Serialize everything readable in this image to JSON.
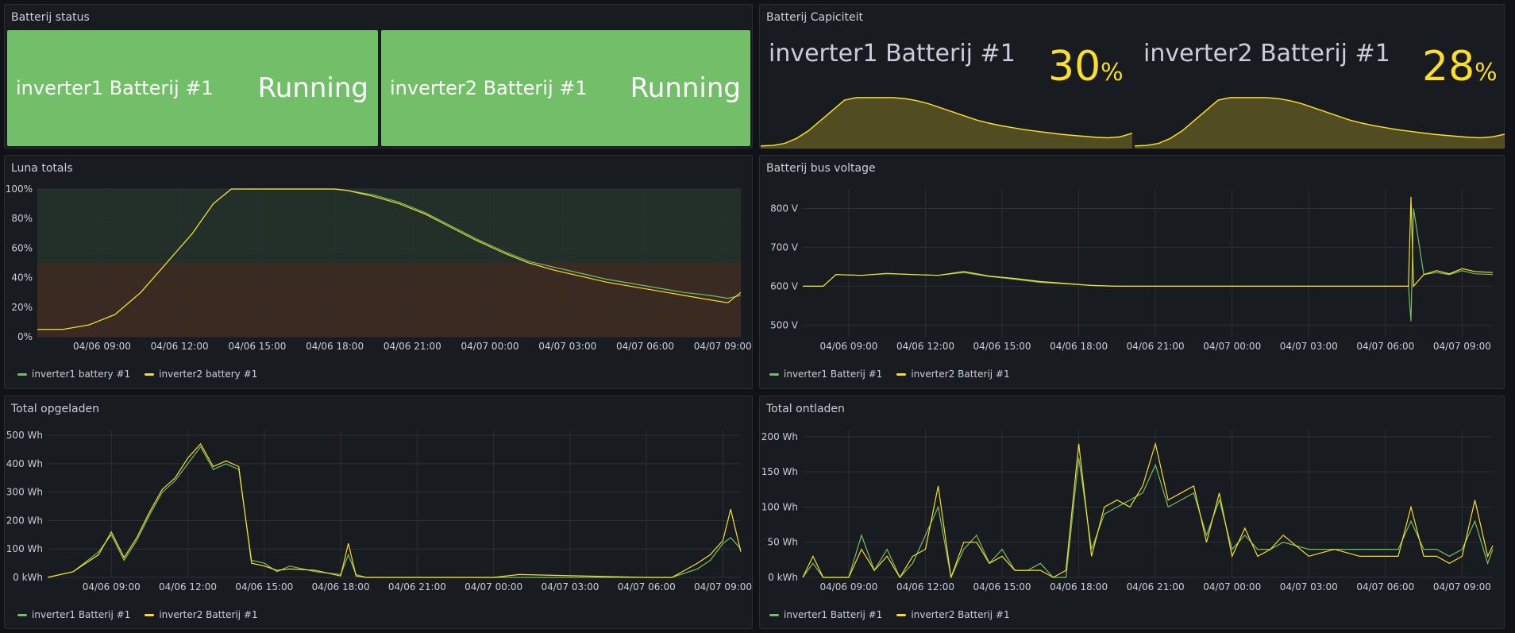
{
  "colors": {
    "green": "#73bf69",
    "yellow": "#fade2a",
    "panel_bg": "#181b1f",
    "page_bg": "#111217"
  },
  "batterij_status": {
    "title": "Batterij status",
    "items": [
      {
        "name": "inverter1 Batterij #1",
        "value": "Running"
      },
      {
        "name": "inverter2 Batterij #1",
        "value": "Running"
      }
    ]
  },
  "batterij_capiciteit": {
    "title": "Batterij Capiciteit",
    "items": [
      {
        "name": "inverter1 Batterij #1",
        "value": "30",
        "unit": "%"
      },
      {
        "name": "inverter2 Batterij #1",
        "value": "28",
        "unit": "%"
      }
    ]
  },
  "luna_totals": {
    "title": "Luna totals",
    "legend": [
      "inverter1 battery #1",
      "inverter2 battery #1"
    ]
  },
  "bus_voltage": {
    "title": "Batterij bus voltage",
    "legend": [
      "inverter1 Batterij #1",
      "inverter2 Batterij #1"
    ]
  },
  "opgeladen": {
    "title": "Total opgeladen",
    "legend": [
      "inverter1 Batterij #1",
      "inverter2 Batterij #1"
    ]
  },
  "ontladen": {
    "title": "Total ontladen",
    "legend": [
      "inverter1 Batterij #1",
      "inverter2 Batterij #1"
    ]
  },
  "chart_data": [
    {
      "type": "area",
      "id": "cap1",
      "series": [
        {
          "name": "inverter1 Batterij #1",
          "values": [
            5,
            6,
            10,
            20,
            35,
            55,
            75,
            95,
            100,
            100,
            100,
            100,
            98,
            94,
            88,
            80,
            72,
            64,
            56,
            50,
            45,
            41,
            37,
            34,
            31,
            28,
            26,
            24,
            22,
            21,
            23,
            30
          ]
        }
      ],
      "ylim": [
        0,
        120
      ]
    },
    {
      "type": "area",
      "id": "cap2",
      "series": [
        {
          "name": "inverter2 Batterij #1",
          "values": [
            5,
            6,
            10,
            20,
            35,
            55,
            75,
            95,
            100,
            100,
            100,
            100,
            98,
            94,
            88,
            80,
            72,
            64,
            56,
            50,
            45,
            41,
            37,
            34,
            31,
            28,
            26,
            24,
            22,
            21,
            23,
            28
          ]
        }
      ],
      "ylim": [
        0,
        120
      ]
    },
    {
      "type": "line",
      "id": "luna",
      "title": "Luna totals",
      "x_ticks": [
        "04/06 09:00",
        "04/06 12:00",
        "04/06 15:00",
        "04/06 18:00",
        "04/06 21:00",
        "04/07 00:00",
        "04/07 03:00",
        "04/07 06:00",
        "04/07 09:00"
      ],
      "y_ticks": [
        "0%",
        "20%",
        "40%",
        "60%",
        "80%",
        "100%"
      ],
      "ylim": [
        0,
        100
      ],
      "xlim": [
        6.5,
        33.7
      ],
      "x": [
        6.5,
        7.5,
        8.5,
        9.5,
        10.5,
        11.5,
        12.5,
        13.3,
        14,
        15,
        16,
        17,
        18,
        18.5,
        19.5,
        20.5,
        21.5,
        22.5,
        23.5,
        24.5,
        25.5,
        26.5,
        27.5,
        28.5,
        29.5,
        30.5,
        31.5,
        32.5,
        33.2,
        33.7
      ],
      "series": [
        {
          "name": "inverter1 battery #1",
          "values": [
            5,
            5,
            8,
            15,
            30,
            50,
            70,
            90,
            100,
            100,
            100,
            100,
            100,
            99,
            96,
            91,
            84,
            75,
            66,
            58,
            51,
            47,
            43,
            39,
            36,
            33,
            30,
            28,
            26,
            28
          ]
        },
        {
          "name": "inverter2 battery #1",
          "values": [
            5,
            5,
            8,
            15,
            30,
            50,
            70,
            90,
            100,
            100,
            100,
            100,
            100,
            99,
            95,
            90,
            83,
            74,
            65,
            57,
            50,
            45,
            41,
            37,
            34,
            31,
            28,
            25,
            23,
            30
          ]
        }
      ],
      "thresholds": [
        {
          "from": 0,
          "to": 50,
          "color": "#3b2a22"
        },
        {
          "from": 50,
          "to": 100,
          "color": "#23302a"
        }
      ]
    },
    {
      "type": "line",
      "id": "voltage",
      "title": "Batterij bus voltage",
      "x_ticks": [
        "04/06 09:00",
        "04/06 12:00",
        "04/06 15:00",
        "04/06 18:00",
        "04/06 21:00",
        "04/07 00:00",
        "04/07 03:00",
        "04/07 06:00",
        "04/07 09:00"
      ],
      "y_ticks": [
        "500 V",
        "600 V",
        "700 V",
        "800 V"
      ],
      "ylim": [
        470,
        850
      ],
      "xlim": [
        7.2,
        34.2
      ],
      "x": [
        7.2,
        8,
        8.5,
        9.5,
        10.5,
        11.5,
        12.5,
        13.5,
        14.5,
        15.5,
        16.5,
        17.5,
        18.5,
        19.5,
        20.5,
        21.5,
        22.5,
        23.5,
        24.5,
        25.5,
        26.5,
        27.5,
        28.5,
        29.5,
        30.5,
        30.9,
        31,
        31.1,
        31.5,
        32,
        32.5,
        33,
        33.5,
        34.2
      ],
      "series": [
        {
          "name": "inverter1 Batterij #1",
          "values": [
            600,
            600,
            630,
            628,
            632,
            630,
            628,
            635,
            625,
            618,
            610,
            606,
            602,
            600,
            600,
            600,
            600,
            600,
            600,
            600,
            600,
            600,
            600,
            600,
            600,
            600,
            510,
            800,
            630,
            635,
            630,
            640,
            632,
            630
          ]
        },
        {
          "name": "inverter2 Batterij #1",
          "values": [
            600,
            600,
            630,
            628,
            633,
            630,
            628,
            638,
            626,
            620,
            612,
            607,
            602,
            600,
            600,
            600,
            600,
            600,
            600,
            600,
            600,
            600,
            600,
            600,
            600,
            600,
            830,
            600,
            630,
            640,
            632,
            645,
            638,
            635
          ]
        }
      ]
    },
    {
      "type": "line",
      "id": "opgeladen",
      "title": "Total opgeladen",
      "x_ticks": [
        "04/06 09:00",
        "04/06 12:00",
        "04/06 15:00",
        "04/06 18:00",
        "04/06 21:00",
        "04/07 00:00",
        "04/07 03:00",
        "04/07 06:00",
        "04/07 09:00"
      ],
      "y_ticks": [
        "0 kWh",
        "100 Wh",
        "200 Wh",
        "300 Wh",
        "400 Wh",
        "500 Wh"
      ],
      "ylim": [
        0,
        520
      ],
      "xlim": [
        6.5,
        33.7
      ],
      "x": [
        6.5,
        7.5,
        8.5,
        9,
        9.5,
        10,
        10.5,
        11,
        11.5,
        12,
        12.5,
        13,
        13.5,
        14,
        14.5,
        15,
        15.5,
        16,
        17,
        18,
        18.3,
        18.6,
        19,
        20,
        24,
        25,
        30,
        31,
        32,
        32.5,
        33,
        33.3,
        33.7
      ],
      "series": [
        {
          "name": "inverter1 Batterij #1",
          "values": [
            0,
            20,
            90,
            150,
            60,
            130,
            220,
            300,
            340,
            400,
            460,
            380,
            400,
            380,
            60,
            50,
            20,
            40,
            20,
            10,
            80,
            10,
            0,
            0,
            0,
            0,
            0,
            0,
            30,
            60,
            120,
            140,
            100
          ]
        },
        {
          "name": "inverter2 Batterij #1",
          "values": [
            0,
            20,
            80,
            160,
            70,
            140,
            230,
            310,
            350,
            420,
            470,
            390,
            410,
            390,
            50,
            40,
            25,
            30,
            25,
            5,
            120,
            5,
            0,
            0,
            0,
            10,
            0,
            0,
            50,
            80,
            130,
            240,
            90
          ]
        }
      ]
    },
    {
      "type": "line",
      "id": "ontladen",
      "title": "Total ontladen",
      "x_ticks": [
        "04/06 09:00",
        "04/06 12:00",
        "04/06 15:00",
        "04/06 18:00",
        "04/06 21:00",
        "04/07 00:00",
        "04/07 03:00",
        "04/07 06:00",
        "04/07 09:00"
      ],
      "y_ticks": [
        "0 kWh",
        "50 Wh",
        "100 Wh",
        "150 Wh",
        "200 Wh"
      ],
      "ylim": [
        0,
        210
      ],
      "xlim": [
        7.2,
        34.2
      ],
      "x": [
        7.2,
        7.6,
        8,
        9,
        9.5,
        10,
        10.5,
        11,
        11.5,
        12,
        12.5,
        13,
        13.5,
        14,
        14.5,
        15,
        15.5,
        16,
        16.5,
        17,
        17.5,
        18,
        18.5,
        19,
        19.5,
        20,
        20.5,
        21,
        21.5,
        22,
        22.5,
        23,
        23.5,
        24,
        24.5,
        25,
        25.5,
        26,
        27,
        28,
        29,
        30,
        30.5,
        31,
        31.5,
        32,
        32.5,
        33,
        33.5,
        34,
        34.2
      ],
      "series": [
        {
          "name": "inverter1 Batterij #1",
          "values": [
            0,
            20,
            0,
            0,
            60,
            10,
            40,
            0,
            20,
            60,
            100,
            0,
            40,
            60,
            20,
            40,
            10,
            10,
            20,
            0,
            0,
            170,
            40,
            90,
            100,
            110,
            120,
            160,
            100,
            110,
            120,
            60,
            110,
            40,
            60,
            40,
            40,
            50,
            40,
            40,
            40,
            40,
            40,
            80,
            40,
            40,
            30,
            40,
            80,
            20,
            40
          ]
        },
        {
          "name": "inverter2 Batterij #1",
          "values": [
            0,
            30,
            0,
            0,
            40,
            10,
            30,
            0,
            30,
            40,
            130,
            0,
            50,
            50,
            20,
            30,
            10,
            10,
            10,
            0,
            10,
            190,
            30,
            100,
            110,
            100,
            130,
            190,
            110,
            120,
            130,
            50,
            120,
            30,
            70,
            30,
            40,
            60,
            30,
            40,
            30,
            30,
            30,
            100,
            30,
            30,
            20,
            30,
            110,
            30,
            45
          ]
        }
      ]
    }
  ]
}
